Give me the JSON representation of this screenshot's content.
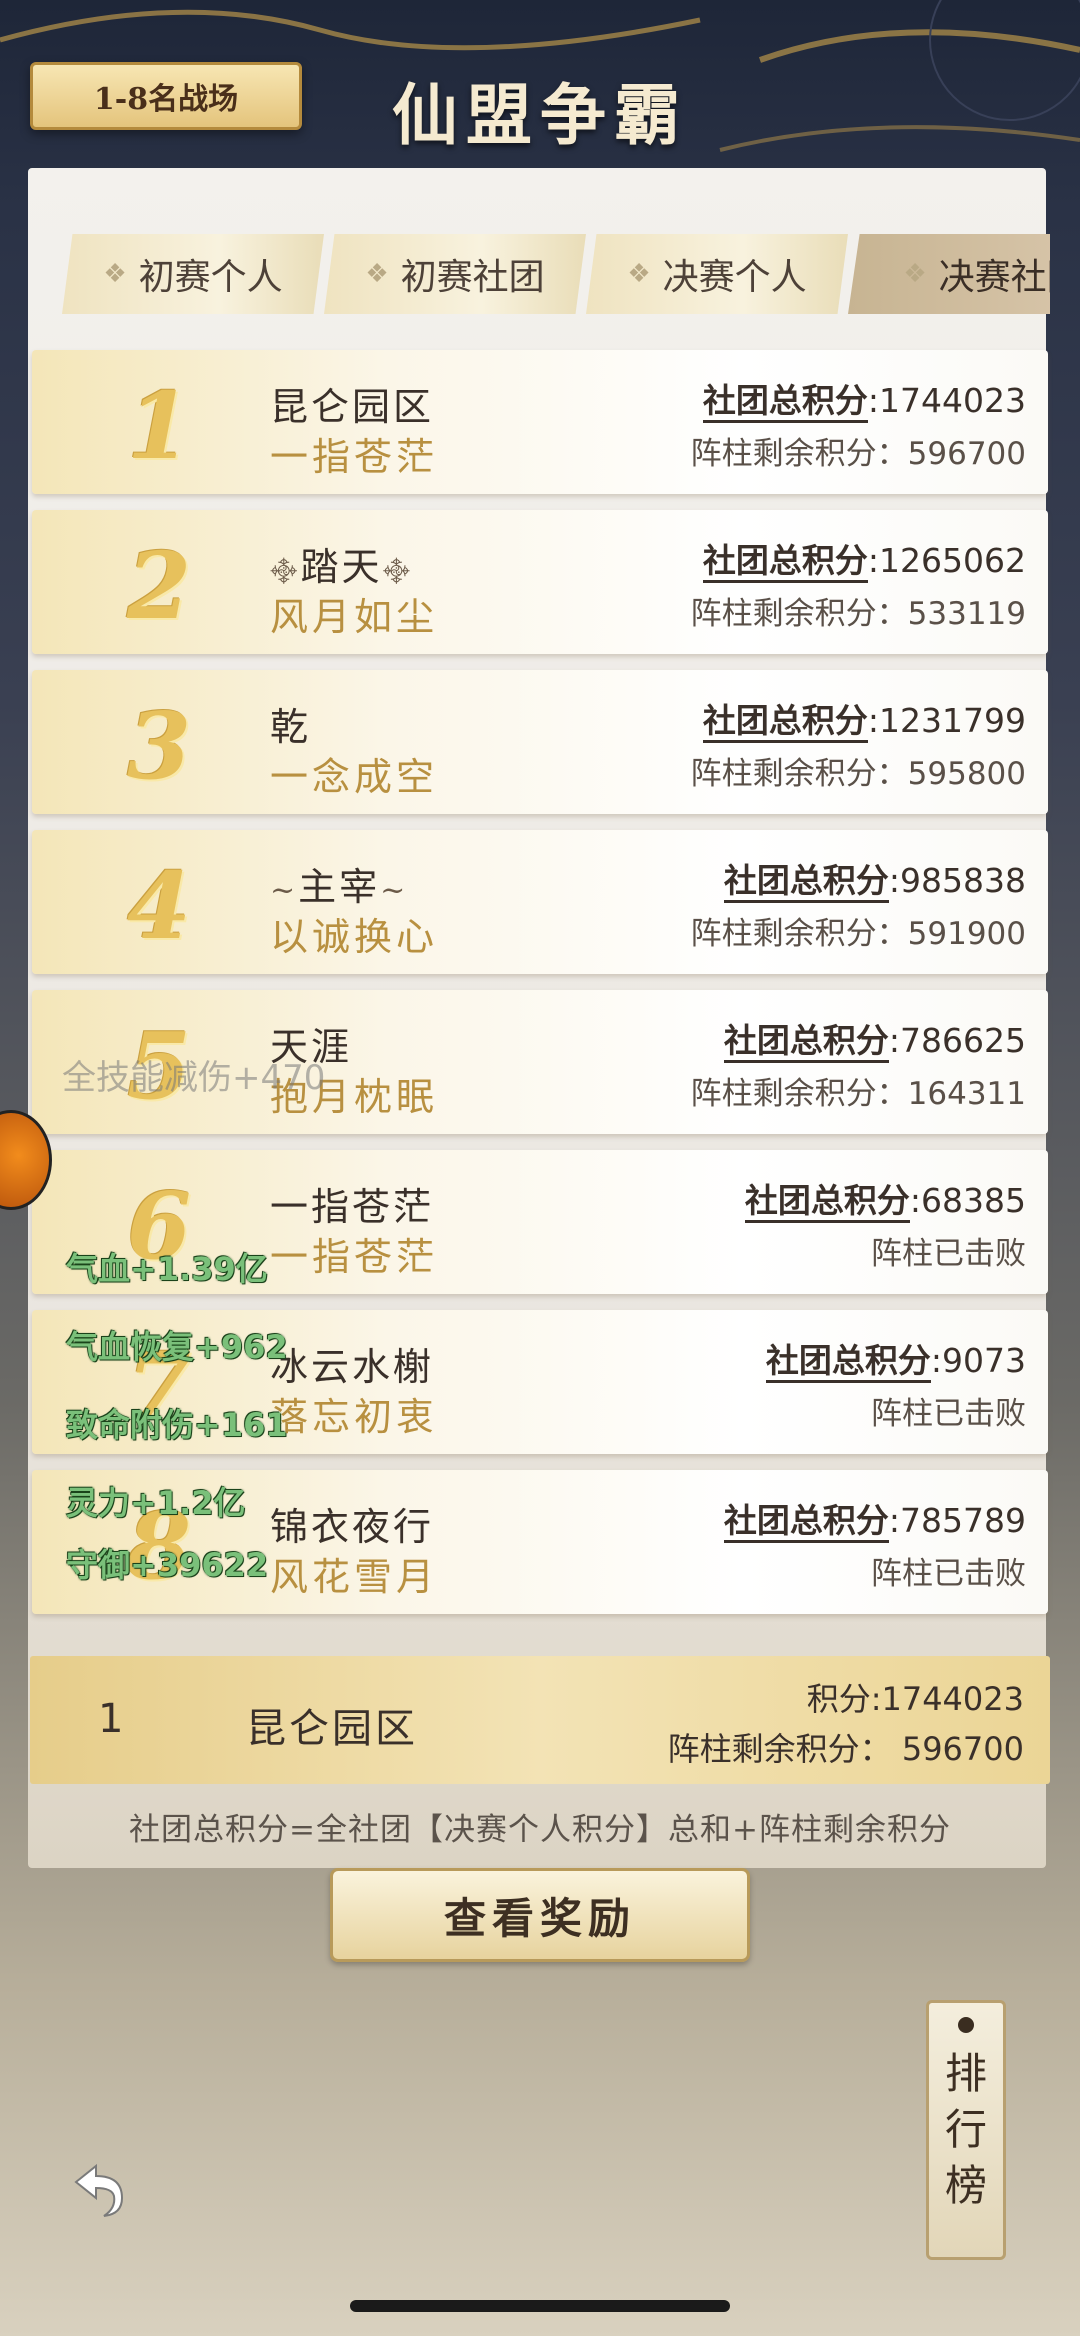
{
  "header": {
    "bracket_label": "1-8名战场",
    "title": "仙盟争霸"
  },
  "tabs": [
    {
      "label": "初赛个人",
      "active": false
    },
    {
      "label": "初赛社团",
      "active": false
    },
    {
      "label": "决赛个人",
      "active": false
    },
    {
      "label": "决赛社团",
      "active": true
    }
  ],
  "rows": [
    {
      "rank": "1",
      "guild": "昆仑园区",
      "leader": "一指苍茫",
      "score_label": "社团总积分",
      "score": ":1744023",
      "pillar_label": "阵柱剩余积分：",
      "pillar": "596700"
    },
    {
      "rank": "2",
      "guild": "踏天",
      "leader": "风月如尘",
      "score_label": "社团总积分",
      "score": ":1265062",
      "pillar_label": "阵柱剩余积分：",
      "pillar": "533119"
    },
    {
      "rank": "3",
      "guild": "乾",
      "leader": "一念成空",
      "score_label": "社团总积分",
      "score": ":1231799",
      "pillar_label": "阵柱剩余积分：",
      "pillar": "595800"
    },
    {
      "rank": "4",
      "guild": "主宰",
      "leader": "以诚换心",
      "score_label": "社团总积分",
      "score": ":985838",
      "pillar_label": "阵柱剩余积分：",
      "pillar": "591900"
    },
    {
      "rank": "5",
      "guild": "天涯",
      "leader": "抱月枕眠",
      "score_label": "社团总积分",
      "score": ":786625",
      "pillar_label": "阵柱剩余积分：",
      "pillar": "164311"
    },
    {
      "rank": "6",
      "guild": "一指苍茫",
      "leader": "一指苍茫",
      "score_label": "社团总积分",
      "score": ":68385",
      "pillar_label": "",
      "pillar": "阵柱已击败"
    },
    {
      "rank": "7",
      "guild": "冰云水榭",
      "leader": "落忘初衷",
      "score_label": "社团总积分",
      "score": ":9073",
      "pillar_label": "",
      "pillar": "阵柱已击败"
    },
    {
      "rank": "8",
      "guild": "锦衣夜行",
      "leader": "风花雪月",
      "score_label": "社团总积分",
      "score": ":785789",
      "pillar_label": "",
      "pillar": "阵柱已击败"
    }
  ],
  "overlay": {
    "watermark": "全技能减伤+470",
    "buffs": [
      "气血+1.39亿",
      "气血恢复+962",
      "致命附伤+161",
      "灵力+1.2亿",
      "守御+39622"
    ]
  },
  "my_team": {
    "rank": "1",
    "name": "昆仑园区",
    "score": "积分:1744023",
    "pillar": "阵柱剩余积分：  596700"
  },
  "formula": "社团总积分=全社团【决赛个人积分】总和+阵柱剩余积分",
  "reward_button": "查看奖励",
  "leaderboard_tag": [
    "排",
    "行",
    "榜"
  ],
  "icons": {
    "back": "back-arrow-icon",
    "diamond": "diamond-icon"
  },
  "colors": {
    "gold": "#e7c15c",
    "buff_green": "#7ac07a"
  }
}
